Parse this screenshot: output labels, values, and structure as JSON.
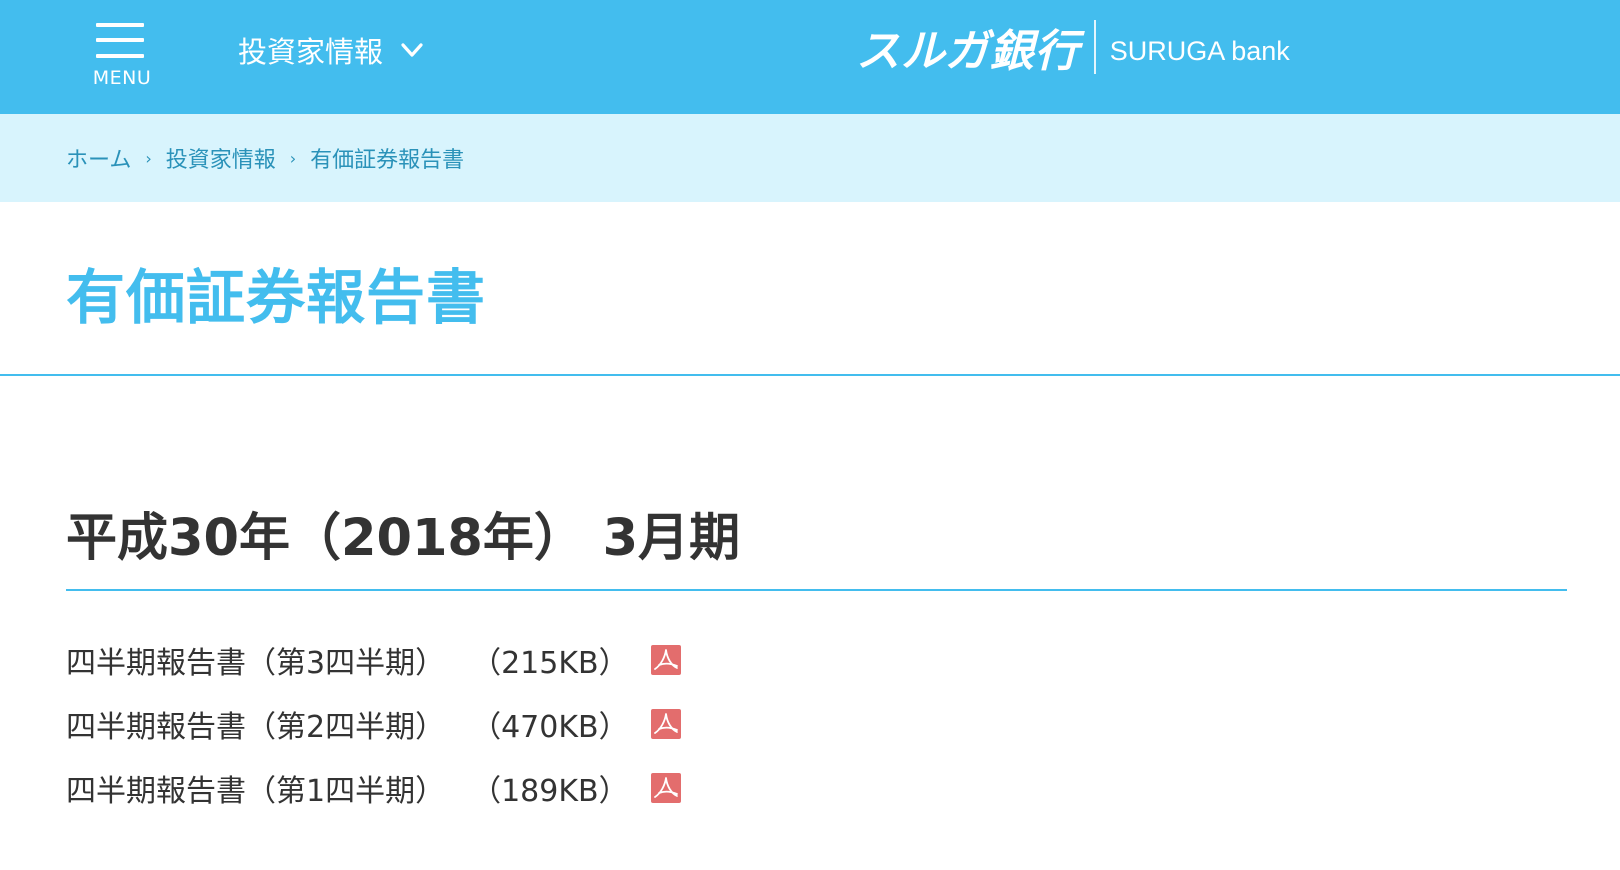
{
  "header": {
    "menu_label": "MENU",
    "dropdown_label": "投資家情報",
    "logo_jp": "スルガ銀行",
    "logo_en": "SURUGA bank",
    "background_color": "#43bdee"
  },
  "breadcrumb": {
    "items": [
      "ホーム",
      "投資家情報",
      "有価証券報告書"
    ],
    "separator": "›"
  },
  "page_title": "有価証券報告書",
  "section": {
    "heading": "平成30年（2018年） 3月期",
    "documents": [
      {
        "name": "四半期報告書（第3四半期）",
        "size": "（215KB）",
        "icon": "pdf-icon"
      },
      {
        "name": "四半期報告書（第2四半期）",
        "size": "（470KB）",
        "icon": "pdf-icon"
      },
      {
        "name": "四半期報告書（第1四半期）",
        "size": "（189KB）",
        "icon": "pdf-icon"
      }
    ]
  },
  "colors": {
    "accent": "#43bdee",
    "breadcrumb_bg": "#d8f4fd",
    "breadcrumb_text": "#2a92b9",
    "pdf_red": "#e36d6d"
  }
}
